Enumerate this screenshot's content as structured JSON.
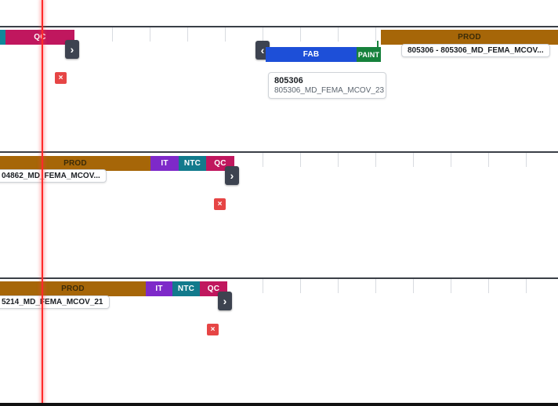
{
  "lanes": [
    {
      "segments": {
        "teal": "",
        "qc": "QC",
        "fab": "FAB",
        "paint": "PAINT",
        "prod": "PROD"
      },
      "labels": {
        "right": "805306 - 805306_MD_FEMA_MCOV..."
      },
      "card": {
        "title": "805306",
        "subtitle": "805306_MD_FEMA_MCOV_23"
      }
    },
    {
      "segments": {
        "prod": "PROD",
        "it": "IT",
        "ntc": "NTC",
        "qc": "QC"
      },
      "labels": {
        "left": "04862_MD_FEMA_MCOV..."
      }
    },
    {
      "segments": {
        "prod": "PROD",
        "it": "IT",
        "ntc": "NTC",
        "qc": "QC"
      },
      "labels": {
        "left": "5214_MD_FEMA_MCOV_21"
      }
    }
  ],
  "icons": {
    "next": "›",
    "prev": "‹",
    "remove": "×"
  },
  "colors": {
    "prod": "#a66608",
    "qc": "#c0175e",
    "it": "#7e29c9",
    "ntc": "#127a8c",
    "fab": "#1d4fd8",
    "paint": "#16813c",
    "current_time": "#ff2a2a"
  }
}
